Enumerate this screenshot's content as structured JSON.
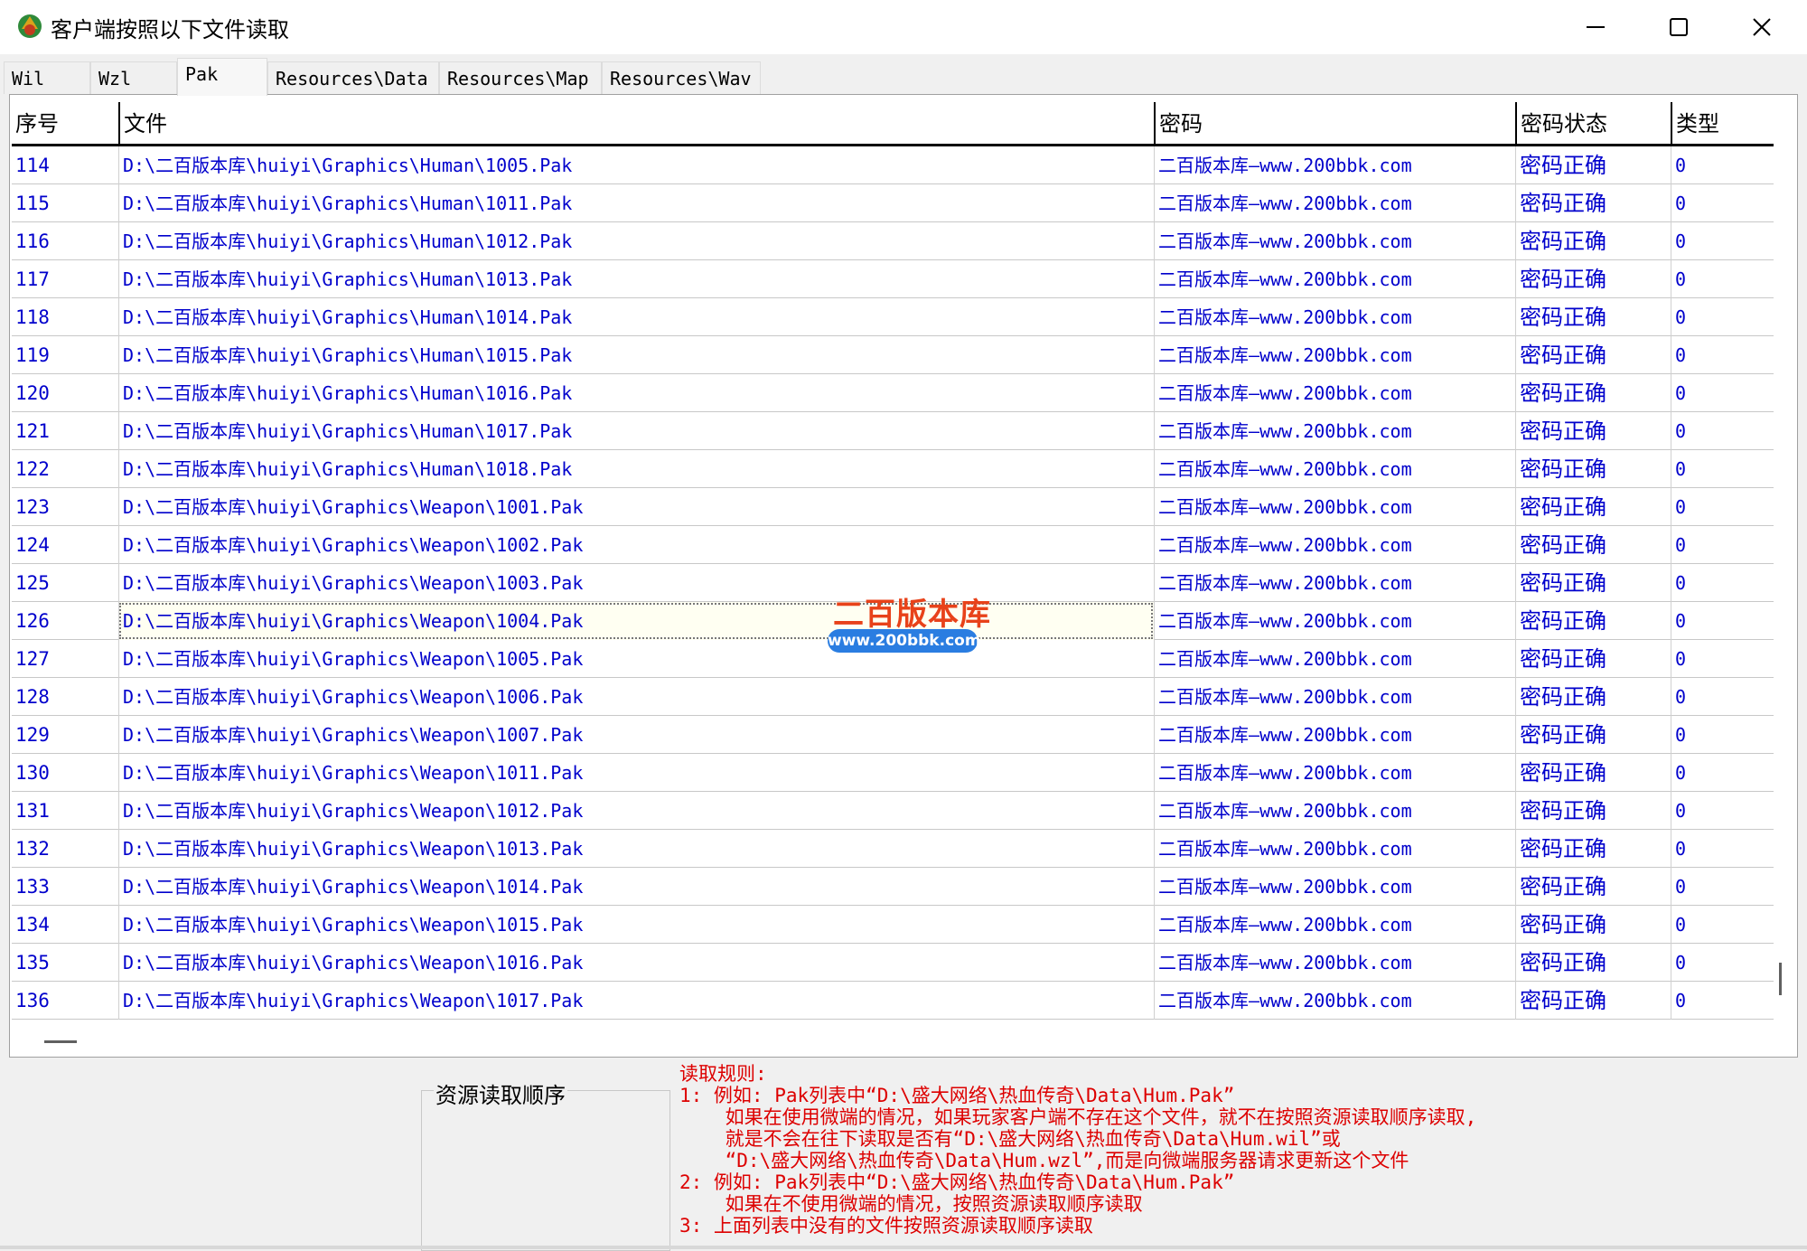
{
  "window": {
    "title": "客户端按照以下文件读取",
    "app_icon": "app-logo-icon",
    "minimize_icon": "minimize-icon",
    "maximize_icon": "maximize-icon",
    "close_icon": "close-icon"
  },
  "tabs": [
    {
      "label": "Wil",
      "active": false
    },
    {
      "label": "Wzl",
      "active": false
    },
    {
      "label": "Pak",
      "active": true
    },
    {
      "label": "Resources\\Data",
      "active": false
    },
    {
      "label": "Resources\\Map",
      "active": false
    },
    {
      "label": "Resources\\Wav",
      "active": false
    }
  ],
  "table": {
    "headers": [
      "序号",
      "文件",
      "密码",
      "密码状态",
      "类型"
    ],
    "focused_row_index": 12,
    "rows": [
      {
        "no": "114",
        "file": "D:\\二百版本库\\huiyi\\Graphics\\Human\\1005.Pak",
        "password": "二百版本库—www.200bbk.com",
        "status": "密码正确",
        "type": "0"
      },
      {
        "no": "115",
        "file": "D:\\二百版本库\\huiyi\\Graphics\\Human\\1011.Pak",
        "password": "二百版本库—www.200bbk.com",
        "status": "密码正确",
        "type": "0"
      },
      {
        "no": "116",
        "file": "D:\\二百版本库\\huiyi\\Graphics\\Human\\1012.Pak",
        "password": "二百版本库—www.200bbk.com",
        "status": "密码正确",
        "type": "0"
      },
      {
        "no": "117",
        "file": "D:\\二百版本库\\huiyi\\Graphics\\Human\\1013.Pak",
        "password": "二百版本库—www.200bbk.com",
        "status": "密码正确",
        "type": "0"
      },
      {
        "no": "118",
        "file": "D:\\二百版本库\\huiyi\\Graphics\\Human\\1014.Pak",
        "password": "二百版本库—www.200bbk.com",
        "status": "密码正确",
        "type": "0"
      },
      {
        "no": "119",
        "file": "D:\\二百版本库\\huiyi\\Graphics\\Human\\1015.Pak",
        "password": "二百版本库—www.200bbk.com",
        "status": "密码正确",
        "type": "0"
      },
      {
        "no": "120",
        "file": "D:\\二百版本库\\huiyi\\Graphics\\Human\\1016.Pak",
        "password": "二百版本库—www.200bbk.com",
        "status": "密码正确",
        "type": "0"
      },
      {
        "no": "121",
        "file": "D:\\二百版本库\\huiyi\\Graphics\\Human\\1017.Pak",
        "password": "二百版本库—www.200bbk.com",
        "status": "密码正确",
        "type": "0"
      },
      {
        "no": "122",
        "file": "D:\\二百版本库\\huiyi\\Graphics\\Human\\1018.Pak",
        "password": "二百版本库—www.200bbk.com",
        "status": "密码正确",
        "type": "0"
      },
      {
        "no": "123",
        "file": "D:\\二百版本库\\huiyi\\Graphics\\Weapon\\1001.Pak",
        "password": "二百版本库—www.200bbk.com",
        "status": "密码正确",
        "type": "0"
      },
      {
        "no": "124",
        "file": "D:\\二百版本库\\huiyi\\Graphics\\Weapon\\1002.Pak",
        "password": "二百版本库—www.200bbk.com",
        "status": "密码正确",
        "type": "0"
      },
      {
        "no": "125",
        "file": "D:\\二百版本库\\huiyi\\Graphics\\Weapon\\1003.Pak",
        "password": "二百版本库—www.200bbk.com",
        "status": "密码正确",
        "type": "0"
      },
      {
        "no": "126",
        "file": "D:\\二百版本库\\huiyi\\Graphics\\Weapon\\1004.Pak",
        "password": "二百版本库—www.200bbk.com",
        "status": "密码正确",
        "type": "0"
      },
      {
        "no": "127",
        "file": "D:\\二百版本库\\huiyi\\Graphics\\Weapon\\1005.Pak",
        "password": "二百版本库—www.200bbk.com",
        "status": "密码正确",
        "type": "0"
      },
      {
        "no": "128",
        "file": "D:\\二百版本库\\huiyi\\Graphics\\Weapon\\1006.Pak",
        "password": "二百版本库—www.200bbk.com",
        "status": "密码正确",
        "type": "0"
      },
      {
        "no": "129",
        "file": "D:\\二百版本库\\huiyi\\Graphics\\Weapon\\1007.Pak",
        "password": "二百版本库—www.200bbk.com",
        "status": "密码正确",
        "type": "0"
      },
      {
        "no": "130",
        "file": "D:\\二百版本库\\huiyi\\Graphics\\Weapon\\1011.Pak",
        "password": "二百版本库—www.200bbk.com",
        "status": "密码正确",
        "type": "0"
      },
      {
        "no": "131",
        "file": "D:\\二百版本库\\huiyi\\Graphics\\Weapon\\1012.Pak",
        "password": "二百版本库—www.200bbk.com",
        "status": "密码正确",
        "type": "0"
      },
      {
        "no": "132",
        "file": "D:\\二百版本库\\huiyi\\Graphics\\Weapon\\1013.Pak",
        "password": "二百版本库—www.200bbk.com",
        "status": "密码正确",
        "type": "0"
      },
      {
        "no": "133",
        "file": "D:\\二百版本库\\huiyi\\Graphics\\Weapon\\1014.Pak",
        "password": "二百版本库—www.200bbk.com",
        "status": "密码正确",
        "type": "0"
      },
      {
        "no": "134",
        "file": "D:\\二百版本库\\huiyi\\Graphics\\Weapon\\1015.Pak",
        "password": "二百版本库—www.200bbk.com",
        "status": "密码正确",
        "type": "0"
      },
      {
        "no": "135",
        "file": "D:\\二百版本库\\huiyi\\Graphics\\Weapon\\1016.Pak",
        "password": "二百版本库—www.200bbk.com",
        "status": "密码正确",
        "type": "0"
      },
      {
        "no": "136",
        "file": "D:\\二百版本库\\huiyi\\Graphics\\Weapon\\1017.Pak",
        "password": "二百版本库—www.200bbk.com",
        "status": "密码正确",
        "type": "0"
      }
    ]
  },
  "watermark": {
    "title": "二百版本库",
    "url": "www.200bbk.com"
  },
  "bottom": {
    "group_label": "资源读取顺序",
    "rules": [
      "读取规则:",
      "1: 例如: Pak列表中“D:\\盛大网络\\热血传奇\\Data\\Hum.Pak”",
      "    如果在使用微端的情况，如果玩家客户端不存在这个文件，就不在按照资源读取顺序读取,",
      "    就是不会在往下读取是否有“D:\\盛大网络\\热血传奇\\Data\\Hum.wil”或",
      "    “D:\\盛大网络\\热血传奇\\Data\\Hum.wzl”,而是向微端服务器请求更新这个文件",
      "2: 例如: Pak列表中“D:\\盛大网络\\热血传奇\\Data\\Hum.Pak”",
      "    如果在不使用微端的情况，按照资源读取顺序读取",
      "3: 上面列表中没有的文件按照资源读取顺序读取"
    ]
  },
  "colors": {
    "link_text": "#0000cc",
    "rule_text": "#dd0000",
    "watermark_red": "#e8421a",
    "watermark_blue": "#2a7de1"
  }
}
